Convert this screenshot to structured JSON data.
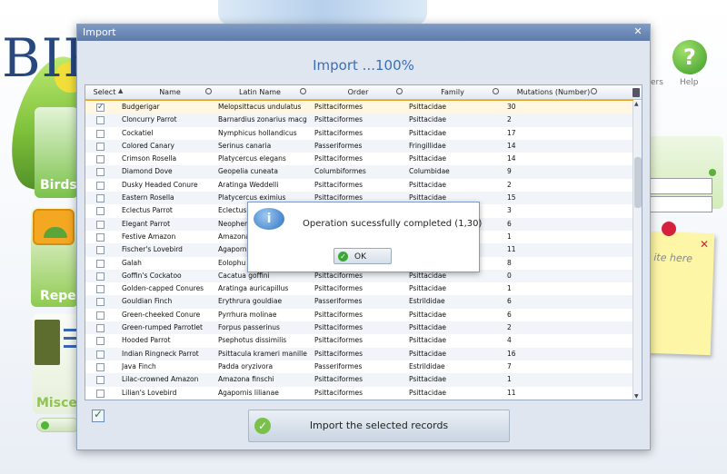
{
  "background": {
    "logo_text": "BIR",
    "tiles": {
      "birds": "Birds",
      "repertoire": "Reper",
      "misc": "Miscel"
    },
    "help_label": "Help",
    "other_label": "ers",
    "sticky_text": "ite here"
  },
  "window": {
    "title": "Import",
    "close_glyph": "✕",
    "heading": "Import ...100%",
    "columns": [
      "Select",
      "Name",
      "Latin Name",
      "Order",
      "Family",
      "Mutations (Number)"
    ],
    "rows": [
      {
        "selected": true,
        "name": "Budgerigar",
        "latin": "Melopsittacus undulatus",
        "order": "Psittaciformes",
        "family": "Psittacidae",
        "mutations": "30"
      },
      {
        "selected": false,
        "name": "Cloncurry Parrot",
        "latin": "Barnardius zonarius macg",
        "order": "Psittaciformes",
        "family": "Psittacidae",
        "mutations": "2"
      },
      {
        "selected": false,
        "name": "Cockatiel",
        "latin": "Nymphicus hollandicus",
        "order": "Psittaciformes",
        "family": "Psittacidae",
        "mutations": "17"
      },
      {
        "selected": false,
        "name": "Colored Canary",
        "latin": "Serinus canaria",
        "order": "Passeriformes",
        "family": "Fringillidae",
        "mutations": "14"
      },
      {
        "selected": false,
        "name": "Crimson Rosella",
        "latin": "Platycercus elegans",
        "order": "Psittaciformes",
        "family": "Psittacidae",
        "mutations": "14"
      },
      {
        "selected": false,
        "name": "Diamond Dove",
        "latin": "Geopelia cuneata",
        "order": "Columbiformes",
        "family": "Columbidae",
        "mutations": "9"
      },
      {
        "selected": false,
        "name": "Dusky Headed Conure",
        "latin": "Aratinga Weddelli",
        "order": "Psittaciformes",
        "family": "Psittacidae",
        "mutations": "2"
      },
      {
        "selected": false,
        "name": "Eastern Rosella",
        "latin": "Platycercus eximius",
        "order": "Psittaciformes",
        "family": "Psittacidae",
        "mutations": "15"
      },
      {
        "selected": false,
        "name": "Eclectus Parrot",
        "latin": "Eclectus",
        "order": "",
        "family": "",
        "mutations": "3"
      },
      {
        "selected": false,
        "name": "Elegant Parrot",
        "latin": "Neophem",
        "order": "",
        "family": "",
        "mutations": "6"
      },
      {
        "selected": false,
        "name": "Festive Amazon",
        "latin": "Amazona",
        "order": "",
        "family": "",
        "mutations": "1"
      },
      {
        "selected": false,
        "name": "Fischer's Lovebird",
        "latin": "Agaporni",
        "order": "",
        "family": "",
        "mutations": "11"
      },
      {
        "selected": false,
        "name": "Galah",
        "latin": "Eolophu",
        "order": "",
        "family": "",
        "mutations": "8"
      },
      {
        "selected": false,
        "name": "Goffin's Cockatoo",
        "latin": "Cacatua goffini",
        "order": "Psittaciformes",
        "family": "Psittacidae",
        "mutations": "0"
      },
      {
        "selected": false,
        "name": "Golden-capped Conures",
        "latin": "Aratinga auricapillus",
        "order": "Psittaciformes",
        "family": "Psittacidae",
        "mutations": "1"
      },
      {
        "selected": false,
        "name": "Gouldian Finch",
        "latin": "Erythrura gouldiae",
        "order": "Passeriformes",
        "family": "Estrildidae",
        "mutations": "6"
      },
      {
        "selected": false,
        "name": "Green-cheeked Conure",
        "latin": "Pyrrhura molinae",
        "order": "Psittaciformes",
        "family": "Psittacidae",
        "mutations": "6"
      },
      {
        "selected": false,
        "name": "Green-rumped Parrotlet",
        "latin": "Forpus passerinus",
        "order": "Psittaciformes",
        "family": "Psittacidae",
        "mutations": "2"
      },
      {
        "selected": false,
        "name": "Hooded Parrot",
        "latin": "Psephotus dissimilis",
        "order": "Psittaciformes",
        "family": "Psittacidae",
        "mutations": "4"
      },
      {
        "selected": false,
        "name": "Indian Ringneck Parrot",
        "latin": "Psittacula krameri manille",
        "order": "Psittaciformes",
        "family": "Psittacidae",
        "mutations": "16"
      },
      {
        "selected": false,
        "name": "Java Finch",
        "latin": "Padda oryzivora",
        "order": "Passeriformes",
        "family": "Estrildidae",
        "mutations": "7"
      },
      {
        "selected": false,
        "name": "Lilac-crowned Amazon",
        "latin": "Amazona finschi",
        "order": "Psittaciformes",
        "family": "Psittacidae",
        "mutations": "1"
      },
      {
        "selected": false,
        "name": "Lilian's Lovebird",
        "latin": "Agapornis lilianae",
        "order": "Psittaciformes",
        "family": "Psittacidae",
        "mutations": "11"
      }
    ],
    "import_button": "Import the selected records"
  },
  "dialog": {
    "message": "Operation sucessfully completed (1,30)",
    "ok_label": "OK",
    "info_glyph": "i"
  }
}
